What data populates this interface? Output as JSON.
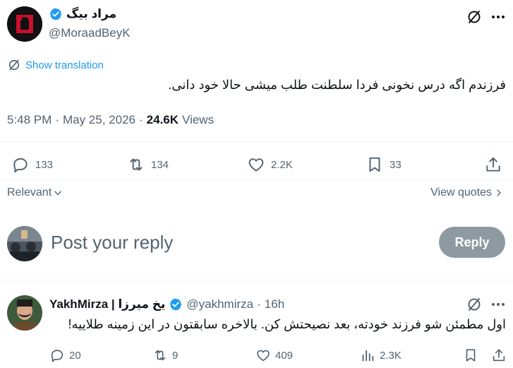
{
  "tweet": {
    "author": {
      "display_name": "مراد بیگ",
      "handle": "@MoraadBeyK",
      "verified": true
    },
    "translate_label": "Show translation",
    "text": "فرزندم اگه درس نخونی فردا سلطنت طلب میشی حالا خود دانی.",
    "time": "5:48 PM",
    "date": "May 25, 2026",
    "views_count": "24.6K",
    "views_label": "Views",
    "separator": "·",
    "stats": {
      "replies": "133",
      "reposts": "134",
      "likes": "2.2K",
      "bookmarks": "33"
    },
    "icons": [
      "grok-icon",
      "more-icon",
      "translate-icon",
      "reply-icon",
      "repost-icon",
      "like-icon",
      "bookmark-icon",
      "share-icon"
    ]
  },
  "filters": {
    "sort_label": "Relevant",
    "view_quotes_label": "View quotes"
  },
  "composer": {
    "placeholder": "Post your reply",
    "reply_button": "Reply"
  },
  "comment": {
    "display_name": "YakhMirza | یخ میرزا",
    "verified": true,
    "handle": "@yakhmirza",
    "separator": "·",
    "time": "16h",
    "text": "اول مطمئن شو فرزند خودته، بعد نصیحتش کن. بالاخره سابقتون در این زمینه طلاییه!",
    "stats": {
      "replies": "20",
      "reposts": "9",
      "likes": "409",
      "views": "2.3K"
    }
  },
  "colors": {
    "accent": "#1d9bf0",
    "secondary_text": "#536471",
    "reply_button_bg": "#8e9aa2"
  }
}
